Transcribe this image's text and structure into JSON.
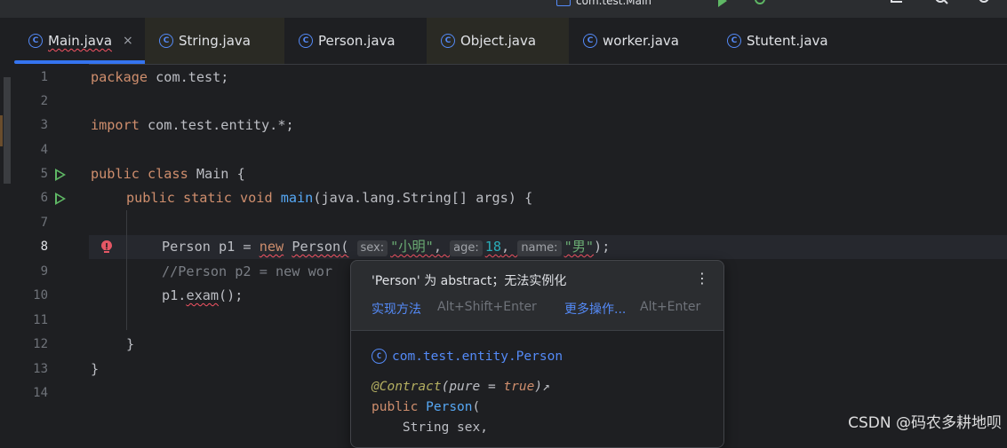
{
  "toolbar": {
    "run_config": "com.test.Main"
  },
  "tabs": [
    {
      "label": "Main.java",
      "active": true,
      "close": "×"
    },
    {
      "label": "String.java"
    },
    {
      "label": "Person.java"
    },
    {
      "label": "Object.java"
    },
    {
      "label": "worker.java"
    },
    {
      "label": "Stutent.java"
    }
  ],
  "line_numbers": [
    "1",
    "2",
    "3",
    "4",
    "5",
    "6",
    "7",
    "8",
    "9",
    "10",
    "11",
    "12",
    "13",
    "14"
  ],
  "code": {
    "l1_kw": "package",
    "l1_rest": " com.test;",
    "l3_kw": "import",
    "l3_rest": " com.test.entity.*;",
    "l5_kw": "public class",
    "l5_rest": " Main {",
    "l6_kw": "public static void",
    "l6_fn": "main",
    "l6_rest": "(java.lang.String[] args) {",
    "l8_type": "Person p1 = ",
    "l8_new": "new",
    "l8_cls": "Person",
    "l8_open": "(",
    "l8_hint1": "sex:",
    "l8_arg1": "\"小明\"",
    "l8_hint2": "age:",
    "l8_arg2": "18",
    "l8_hint3": "name:",
    "l8_arg3": "\"男\"",
    "l8_close": ");",
    "l9": "//Person p2 = new wor",
    "l10_obj": "p1.",
    "l10_m": "exam",
    "l10_rest": "();",
    "l12": "}",
    "l13": "}"
  },
  "popup": {
    "message": "'Person' 为 abstract；无法实例化",
    "more_icon": "⋮",
    "action1": "实现方法",
    "shortcut1": "Alt+Shift+Enter",
    "action2": "更多操作...",
    "shortcut2": "Alt+Enter",
    "doc_class": "com.test.entity.Person",
    "doc_ann": "@Contract",
    "doc_ann_args_open": "(",
    "doc_ann_pure": "pure",
    "doc_ann_eq": " = ",
    "doc_ann_true": "true",
    "doc_ann_close": ")",
    "doc_ann_link": "↗",
    "doc_kw": "public",
    "doc_ctor": "Person",
    "doc_paren": "(",
    "doc_param1": "    String sex,"
  },
  "watermark": "CSDN @码农多耕地呗",
  "colors": {
    "accent": "#3574f0",
    "keyword": "#cf8e6d",
    "function": "#56a8f5",
    "string": "#6aab73",
    "number": "#2aacb8",
    "error": "#f75464"
  }
}
